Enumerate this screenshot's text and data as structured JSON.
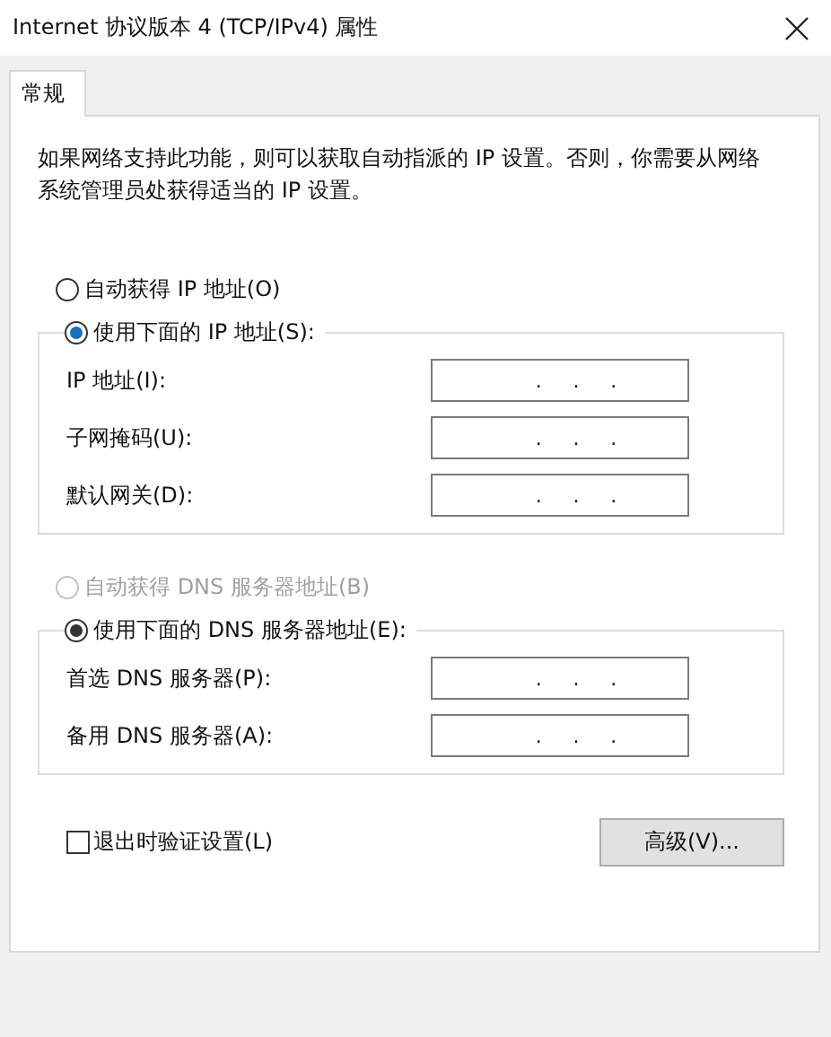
{
  "window": {
    "title": "Internet 协议版本 4 (TCP/IPv4) 属性"
  },
  "tabs": [
    {
      "label": "常规",
      "selected": true
    }
  ],
  "description": "如果网络支持此功能，则可以获取自动指派的 IP 设置。否则，你需要从网络系统管理员处获得适当的 IP 设置。",
  "groups": [
    {
      "auto_option": {
        "label": "自动获得 IP 地址(O)",
        "selected": false,
        "disabled": false
      },
      "manual_option": {
        "label": "使用下面的 IP 地址(S):",
        "selected": true,
        "disabled": false
      },
      "fields": [
        {
          "label": "IP 地址(I):",
          "separators": [
            ".",
            ".",
            "."
          ]
        },
        {
          "label": "子网掩码(U):",
          "separators": [
            ".",
            ".",
            "."
          ]
        },
        {
          "label": "默认网关(D):",
          "separators": [
            ".",
            ".",
            "."
          ]
        }
      ]
    },
    {
      "auto_option": {
        "label": "自动获得 DNS 服务器地址(B)",
        "selected": false,
        "disabled": true
      },
      "manual_option": {
        "label": "使用下面的 DNS 服务器地址(E):",
        "selected": true,
        "disabled": false
      },
      "fields": [
        {
          "label": "首选 DNS 服务器(P):",
          "separators": [
            ".",
            ".",
            "."
          ]
        },
        {
          "label": "备用 DNS 服务器(A):",
          "separators": [
            ".",
            ".",
            "."
          ]
        }
      ]
    }
  ],
  "validate_on_exit": {
    "label": "退出时验证设置(L)",
    "checked": false
  },
  "advanced_button": "高级(V)..."
}
